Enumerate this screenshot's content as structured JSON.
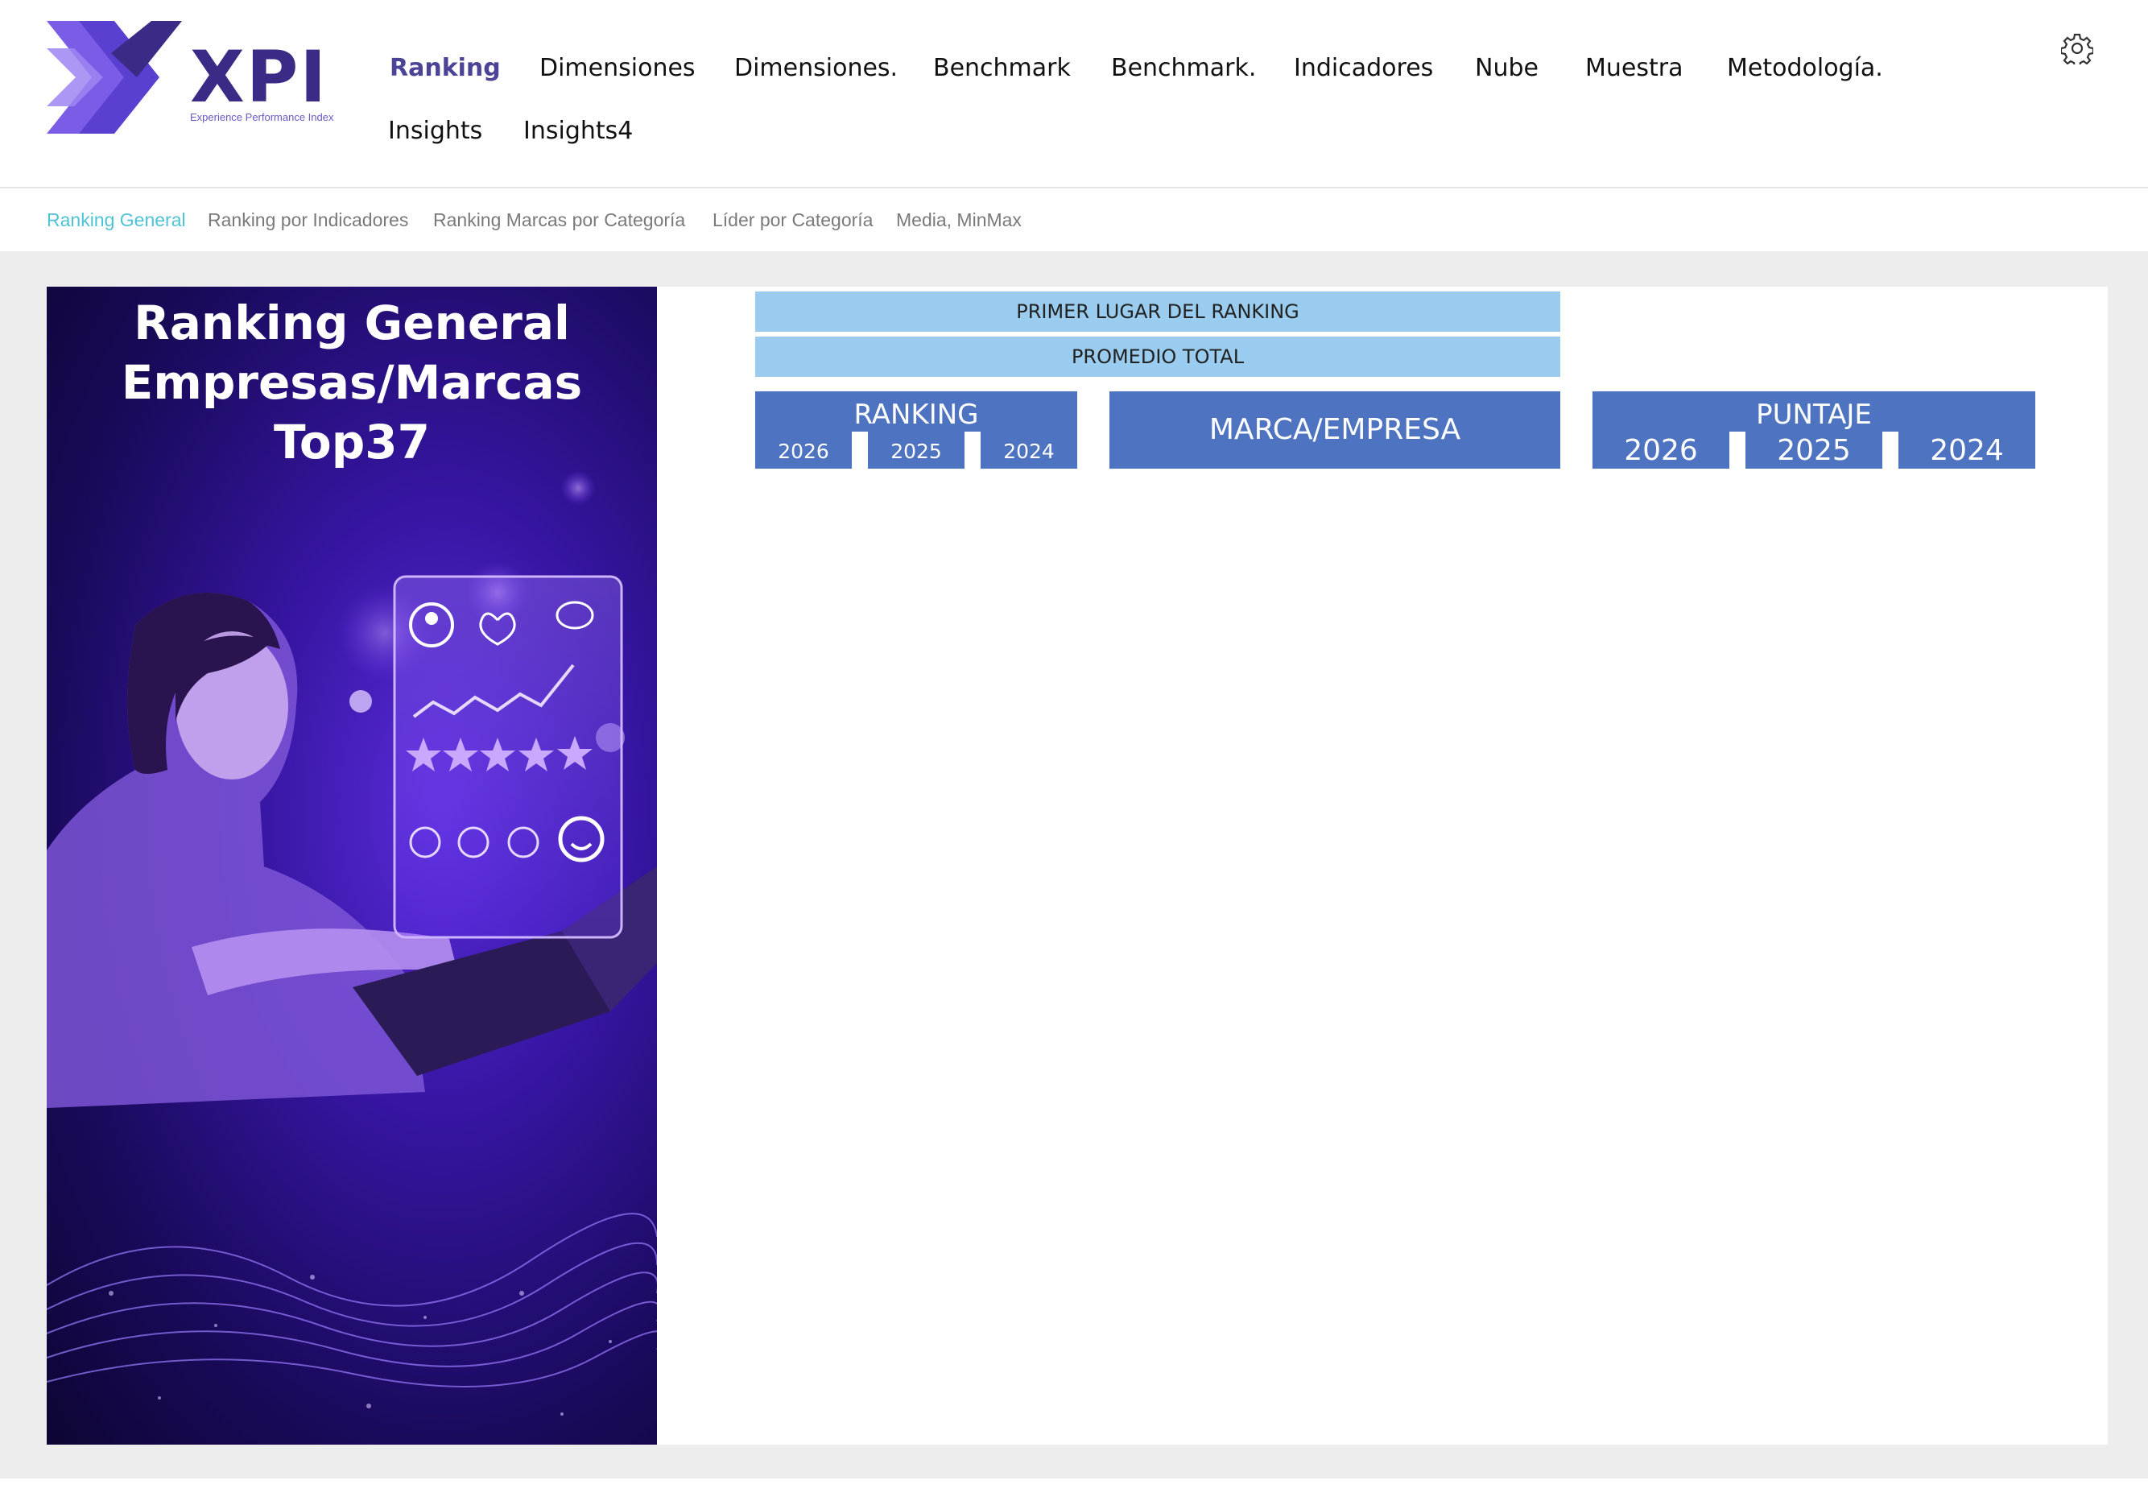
{
  "brand": {
    "name": "XPI",
    "tagline": "Experience Performance Index",
    "primary_color": "#3b2a86",
    "accent_color": "#6a58c6"
  },
  "nav": {
    "items": [
      {
        "label": "Ranking",
        "active": true
      },
      {
        "label": "Dimensiones"
      },
      {
        "label": "Dimensiones."
      },
      {
        "label": "Benchmark"
      },
      {
        "label": "Benchmark."
      },
      {
        "label": "Indicadores"
      },
      {
        "label": "Nube"
      },
      {
        "label": "Muestra"
      },
      {
        "label": "Metodología."
      },
      {
        "label": "Insights"
      },
      {
        "label": "Insights4"
      }
    ],
    "settings_icon": "gear-icon"
  },
  "subnav": {
    "items": [
      {
        "label": "Ranking General",
        "active": true
      },
      {
        "label": "Ranking por Indicadores"
      },
      {
        "label": "Ranking Marcas por Categoría"
      },
      {
        "label": "Líder por Categoría"
      },
      {
        "label": "Media, MinMax"
      }
    ],
    "active_color": "#4fc3d6"
  },
  "hero": {
    "title_lines": [
      "Ranking General",
      "Empresas/Marcas",
      "Top37"
    ]
  },
  "table": {
    "first_place_label": "PRIMER LUGAR DEL RANKING",
    "average_label": "PROMEDIO TOTAL",
    "ranking_header": "RANKING",
    "ranking_years": [
      "2026",
      "2025",
      "2024"
    ],
    "brand_header": "MARCA/EMPRESA",
    "score_header": "PUNTAJE",
    "score_years": [
      "2026",
      "2025",
      "2024"
    ],
    "light_bar_color": "#99ccee",
    "header_color": "#4e73c0"
  }
}
